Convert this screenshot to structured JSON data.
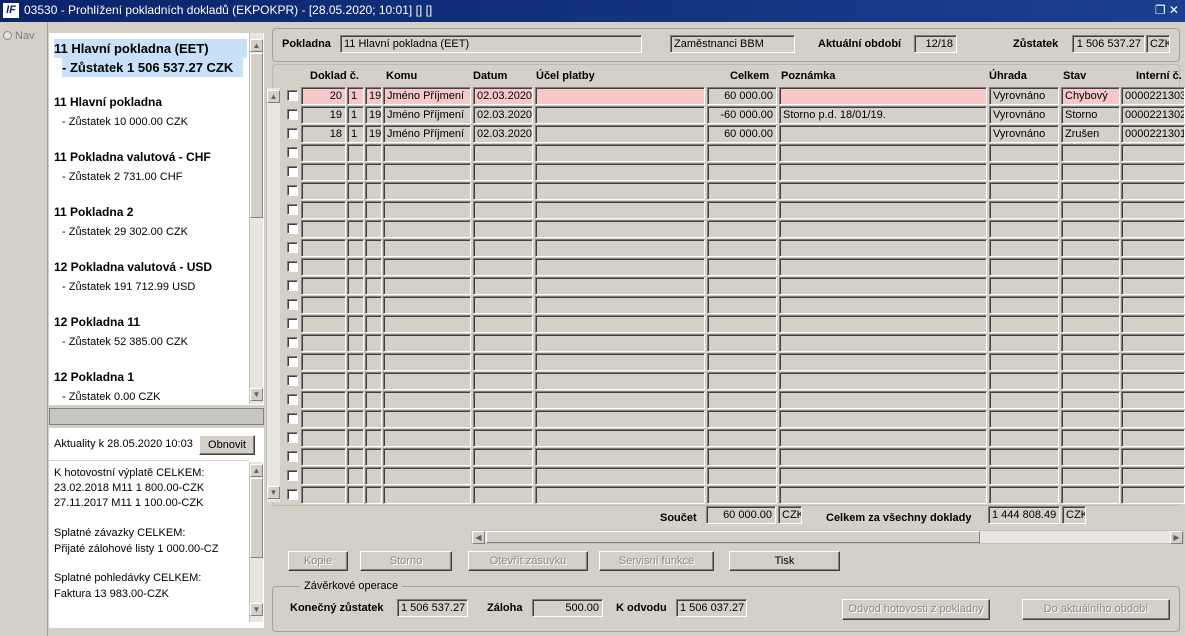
{
  "window": {
    "title": "03530 - Prohlížení pokladních dokladů (EKPOKPR) - [28.05.2020; 10:01] [] []",
    "logo": "IF",
    "controls": "❐ ✕"
  },
  "nav": {
    "label": "Nav"
  },
  "cashboxes": [
    {
      "name": "11 Hlavní pokladna (EET)",
      "balance": "- Zůstatek 1 506 537.27 CZK",
      "selected": true
    },
    {
      "name": "11 Hlavní pokladna",
      "balance": "- Zůstatek 10 000.00 CZK"
    },
    {
      "name": "11 Pokladna valutová - CHF",
      "balance": "- Zůstatek 2 731.00 CHF"
    },
    {
      "name": "11 Pokladna 2",
      "balance": "- Zůstatek 29 302.00 CZK"
    },
    {
      "name": "12 Pokladna valutová - USD",
      "balance": "- Zůstatek 191 712.99 USD"
    },
    {
      "name": "12 Pokladna 11",
      "balance": "- Zůstatek 52 385.00 CZK"
    },
    {
      "name": "12 Pokladna 1",
      "balance": "- Zůstatek 0.00 CZK"
    }
  ],
  "info": {
    "actuality": "Aktuality k 28.05.2020 10:03",
    "refresh": "Obnovit",
    "lines": [
      "K hotovostní výplatě CELKEM:",
      "23.02.2018 M11        1 800.00-CZK",
      "27.11.2017 M11        1 100.00-CZK",
      "",
      "Splatné závazky CELKEM:",
      "Přijaté zálohové listy          1 000.00-CZ",
      "",
      "Splatné pohledávky CELKEM:",
      "Faktura          13 983.00-CZK"
    ]
  },
  "header": {
    "pokladna_label": "Pokladna",
    "pokladna_value": "11 Hlavní pokladna (EET)",
    "group_value": "Zaměstnanci BBM",
    "period_label": "Aktuální období",
    "period_value": "12/18",
    "balance_label": "Zůstatek",
    "balance_value": "1 506 537.27",
    "currency": "CZK"
  },
  "table": {
    "columns": [
      "Doklad č.",
      "Komu",
      "Datum",
      "Účel platby",
      "Celkem",
      "Poznámka",
      "Úhrada",
      "Stav",
      "Interní č."
    ],
    "rows": [
      {
        "doc": "20",
        "a": "1",
        "b": "19",
        "komu": "Jméno Příjmení",
        "datum": "02.03.2020",
        "ucel": "",
        "celkem": "60 000.00",
        "pozn": "",
        "uhrada": "Vyrovnáno",
        "stav": "Chybový",
        "interni": "0000221303"
      },
      {
        "doc": "19",
        "a": "1",
        "b": "19",
        "komu": "Jméno Příjmení",
        "datum": "02.03.2020",
        "ucel": "",
        "celkem": "-60 000.00",
        "pozn": "Storno p.d. 18/01/19.",
        "uhrada": "Vyrovnáno",
        "stav": "Storno",
        "interni": "0000221302"
      },
      {
        "doc": "18",
        "a": "1",
        "b": "19",
        "komu": "Jméno Příjmení",
        "datum": "02.03.2020",
        "ucel": "",
        "celkem": "60 000.00",
        "pozn": "",
        "uhrada": "Vyrovnáno",
        "stav": "Zrušen",
        "interni": "0000221301"
      }
    ]
  },
  "totals": {
    "sum_label": "Součet",
    "sum_value": "60 000.00",
    "sum_cur": "CZK",
    "all_label": "Celkem za všechny doklady",
    "all_value": "1 444 808.49",
    "all_cur": "CZK"
  },
  "buttons": {
    "kopie": "Kopie",
    "storno": "Storno",
    "zasuvka": "Otevřít zásuvku",
    "servis": "Servisní funkce",
    "tisk": "Tisk"
  },
  "closing": {
    "title": "Závěrkové operace",
    "final_label": "Konečný zůstatek",
    "final_value": "1 506 537.27",
    "advance_label": "Záloha",
    "advance_value": "500.00",
    "transfer_label": "K odvodu",
    "transfer_value": "1 506 037.27",
    "btn_transfer": "Odvod hotovosti z pokladny",
    "btn_period": "Do aktuálního období"
  }
}
